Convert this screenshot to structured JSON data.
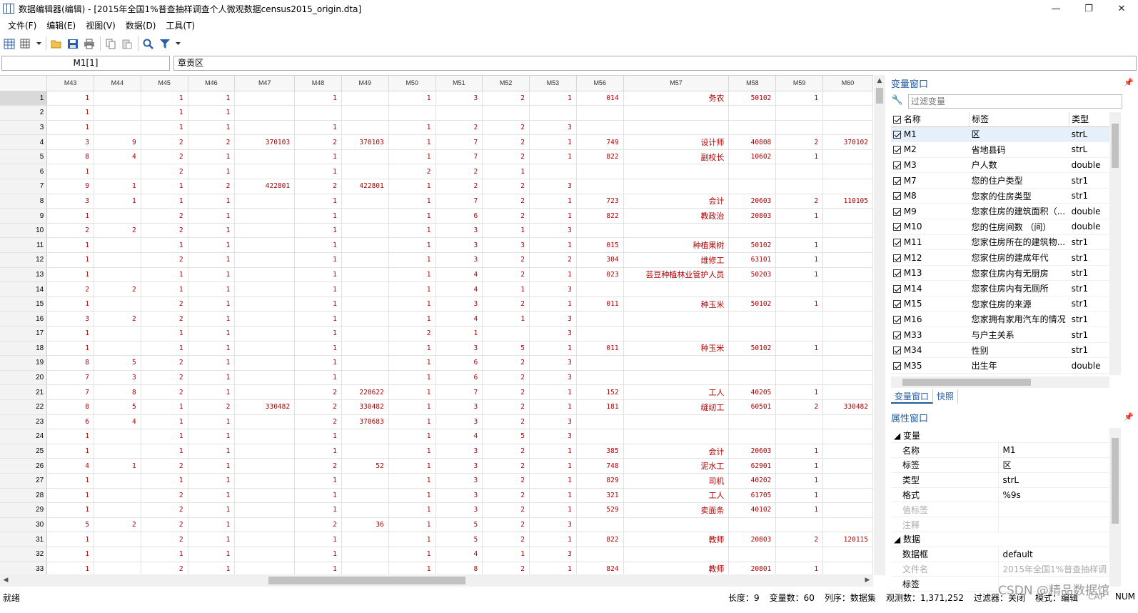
{
  "window": {
    "title": "数据编辑器(编辑) - [2015年全国1%普查抽样调查个人微观数据census2015_origin.dta]",
    "minimize": "—",
    "maximize": "❐",
    "close": "✕"
  },
  "menu": [
    "文件(F)",
    "编辑(E)",
    "视图(V)",
    "数据(D)",
    "工具(T)"
  ],
  "cellbar": {
    "name": "M1[1]",
    "value": "章贡区"
  },
  "grid": {
    "columns": [
      "M43",
      "M44",
      "M45",
      "M46",
      "M47",
      "M48",
      "M49",
      "M50",
      "M51",
      "M52",
      "M53",
      "M56",
      "M57",
      "M58",
      "M59",
      "M60"
    ],
    "rows": [
      [
        "1",
        "1",
        "",
        "1",
        "1",
        "",
        "1",
        "",
        "1",
        "3",
        "2",
        "1",
        "014",
        "务农",
        "50102",
        "1",
        ""
      ],
      [
        "2",
        "1",
        "",
        "1",
        "1",
        "",
        "",
        "",
        "",
        "",
        "",
        "",
        "",
        "",
        "",
        "",
        ""
      ],
      [
        "3",
        "1",
        "",
        "1",
        "1",
        "",
        "1",
        "",
        "1",
        "2",
        "2",
        "3",
        "",
        "",
        "",
        "",
        ""
      ],
      [
        "4",
        "3",
        "9",
        "2",
        "2",
        "370103",
        "2",
        "370103",
        "1",
        "7",
        "2",
        "1",
        "749",
        "设计师",
        "40808",
        "2",
        "370102"
      ],
      [
        "5",
        "8",
        "4",
        "2",
        "1",
        "",
        "1",
        "",
        "1",
        "7",
        "2",
        "1",
        "822",
        "副校长",
        "10602",
        "1",
        ""
      ],
      [
        "6",
        "1",
        "",
        "2",
        "1",
        "",
        "1",
        "",
        "2",
        "2",
        "1",
        "",
        "",
        "",
        "",
        "",
        ""
      ],
      [
        "7",
        "9",
        "1",
        "1",
        "2",
        "422801",
        "2",
        "422801",
        "1",
        "2",
        "2",
        "3",
        "",
        "",
        "",
        "",
        ""
      ],
      [
        "8",
        "3",
        "1",
        "1",
        "1",
        "",
        "1",
        "",
        "1",
        "7",
        "2",
        "1",
        "723",
        "会计",
        "20603",
        "2",
        "110105"
      ],
      [
        "9",
        "1",
        "",
        "2",
        "1",
        "",
        "1",
        "",
        "1",
        "6",
        "2",
        "1",
        "822",
        "教政治",
        "20803",
        "1",
        ""
      ],
      [
        "10",
        "2",
        "2",
        "2",
        "1",
        "",
        "1",
        "",
        "1",
        "3",
        "1",
        "3",
        "",
        "",
        "",
        "",
        ""
      ],
      [
        "11",
        "1",
        "",
        "1",
        "1",
        "",
        "1",
        "",
        "1",
        "3",
        "3",
        "1",
        "015",
        "种植果树",
        "50102",
        "1",
        ""
      ],
      [
        "12",
        "1",
        "",
        "2",
        "1",
        "",
        "1",
        "",
        "1",
        "3",
        "2",
        "2",
        "304",
        "维修工",
        "63101",
        "1",
        ""
      ],
      [
        "13",
        "1",
        "",
        "1",
        "1",
        "",
        "1",
        "",
        "1",
        "4",
        "2",
        "1",
        "023",
        "芸豆种植林业管护人员",
        "50203",
        "1",
        ""
      ],
      [
        "14",
        "2",
        "2",
        "1",
        "1",
        "",
        "1",
        "",
        "1",
        "4",
        "1",
        "3",
        "",
        "",
        "",
        "",
        ""
      ],
      [
        "15",
        "1",
        "",
        "2",
        "1",
        "",
        "1",
        "",
        "1",
        "3",
        "2",
        "1",
        "011",
        "种玉米",
        "50102",
        "1",
        ""
      ],
      [
        "16",
        "3",
        "2",
        "2",
        "1",
        "",
        "1",
        "",
        "1",
        "4",
        "1",
        "3",
        "",
        "",
        "",
        "",
        ""
      ],
      [
        "17",
        "1",
        "",
        "1",
        "1",
        "",
        "1",
        "",
        "2",
        "1",
        "",
        "3",
        "",
        "",
        "",
        "",
        ""
      ],
      [
        "18",
        "1",
        "",
        "1",
        "1",
        "",
        "1",
        "",
        "1",
        "3",
        "5",
        "1",
        "011",
        "种玉米",
        "50102",
        "1",
        ""
      ],
      [
        "19",
        "8",
        "5",
        "2",
        "1",
        "",
        "1",
        "",
        "1",
        "6",
        "2",
        "3",
        "",
        "",
        "",
        "",
        ""
      ],
      [
        "20",
        "7",
        "3",
        "2",
        "1",
        "",
        "1",
        "",
        "1",
        "6",
        "2",
        "3",
        "",
        "",
        "",
        "",
        ""
      ],
      [
        "21",
        "7",
        "8",
        "2",
        "1",
        "",
        "2",
        "220622",
        "1",
        "7",
        "2",
        "1",
        "152",
        "工人",
        "40205",
        "1",
        ""
      ],
      [
        "22",
        "8",
        "5",
        "1",
        "2",
        "330482",
        "2",
        "330482",
        "1",
        "3",
        "2",
        "1",
        "181",
        "缝纫工",
        "60501",
        "2",
        "330482"
      ],
      [
        "23",
        "6",
        "4",
        "1",
        "1",
        "",
        "2",
        "370683",
        "1",
        "3",
        "2",
        "3",
        "",
        "",
        "",
        "",
        ""
      ],
      [
        "24",
        "1",
        "",
        "1",
        "1",
        "",
        "1",
        "",
        "1",
        "4",
        "5",
        "3",
        "",
        "",
        "",
        "",
        ""
      ],
      [
        "25",
        "1",
        "",
        "1",
        "1",
        "",
        "1",
        "",
        "1",
        "3",
        "2",
        "1",
        "385",
        "会计",
        "20603",
        "1",
        ""
      ],
      [
        "26",
        "4",
        "1",
        "2",
        "1",
        "",
        "2",
        "52",
        "1",
        "3",
        "2",
        "1",
        "748",
        "泥水工",
        "62901",
        "1",
        ""
      ],
      [
        "27",
        "1",
        "",
        "1",
        "1",
        "",
        "1",
        "",
        "1",
        "3",
        "2",
        "1",
        "829",
        "司机",
        "40202",
        "1",
        ""
      ],
      [
        "28",
        "1",
        "",
        "2",
        "1",
        "",
        "1",
        "",
        "1",
        "3",
        "2",
        "1",
        "321",
        "工人",
        "61705",
        "1",
        ""
      ],
      [
        "29",
        "1",
        "",
        "2",
        "1",
        "",
        "1",
        "",
        "1",
        "3",
        "2",
        "1",
        "529",
        "卖面条",
        "40102",
        "1",
        ""
      ],
      [
        "30",
        "5",
        "2",
        "2",
        "1",
        "",
        "2",
        "36",
        "1",
        "5",
        "2",
        "3",
        "",
        "",
        "",
        "",
        ""
      ],
      [
        "31",
        "1",
        "",
        "2",
        "1",
        "",
        "1",
        "",
        "1",
        "5",
        "2",
        "1",
        "822",
        "教师",
        "20803",
        "2",
        "120115"
      ],
      [
        "32",
        "1",
        "",
        "1",
        "1",
        "",
        "1",
        "",
        "1",
        "4",
        "1",
        "3",
        "",
        "",
        "",
        "",
        ""
      ],
      [
        "33",
        "1",
        "",
        "2",
        "1",
        "",
        "1",
        "",
        "1",
        "8",
        "2",
        "1",
        "824",
        "教师",
        "20801",
        "1",
        ""
      ]
    ]
  },
  "var_window": {
    "title": "变量窗口",
    "filter_placeholder": "过滤变量",
    "headers": {
      "name": "名称",
      "label": "标签",
      "type": "类型"
    },
    "vars": [
      {
        "name": "M1",
        "label": "区",
        "type": "strL"
      },
      {
        "name": "M2",
        "label": "省地县码",
        "type": "strL"
      },
      {
        "name": "M3",
        "label": "户人数",
        "type": "double"
      },
      {
        "name": "M7",
        "label": "您的住户类型",
        "type": "str1"
      },
      {
        "name": "M8",
        "label": "您家的住房类型",
        "type": "str1"
      },
      {
        "name": "M9",
        "label": "您家住房的建筑面积（...",
        "type": "double"
      },
      {
        "name": "M10",
        "label": "您的住房间数 （间）",
        "type": "double"
      },
      {
        "name": "M11",
        "label": "您家住房所在的建筑物...",
        "type": "str1"
      },
      {
        "name": "M12",
        "label": "您家住房的建成年代",
        "type": "str1"
      },
      {
        "name": "M13",
        "label": "您家住房内有无厨房",
        "type": "str1"
      },
      {
        "name": "M14",
        "label": "您家住房内有无厕所",
        "type": "str1"
      },
      {
        "name": "M15",
        "label": "您家住房的来源",
        "type": "str1"
      },
      {
        "name": "M16",
        "label": "您家拥有家用汽车的情况",
        "type": "str1"
      },
      {
        "name": "M33",
        "label": "与户主关系",
        "type": "str1"
      },
      {
        "name": "M34",
        "label": "性别",
        "type": "str1"
      },
      {
        "name": "M35",
        "label": "出生年",
        "type": "double"
      }
    ],
    "tabs": [
      "变量窗口",
      "快照"
    ]
  },
  "prop_window": {
    "title": "属性窗口",
    "group_var": "变量",
    "var_props": [
      {
        "k": "名称",
        "v": "M1",
        "dim": false
      },
      {
        "k": "标签",
        "v": "区",
        "dim": false
      },
      {
        "k": "类型",
        "v": "strL",
        "dim": false
      },
      {
        "k": "格式",
        "v": "%9s",
        "dim": false
      },
      {
        "k": "值标签",
        "v": "",
        "dim": true
      },
      {
        "k": "注释",
        "v": "",
        "dim": true
      }
    ],
    "group_data": "数据",
    "data_props": [
      {
        "k": "数据框",
        "v": "default",
        "dim": false
      },
      {
        "k": "文件名",
        "v": "2015年全国1%普查抽样调",
        "dim": true
      },
      {
        "k": "标签",
        "v": "",
        "dim": false
      }
    ]
  },
  "status": {
    "left": "就绪",
    "length": "长度：9",
    "varcount": "变量数：60",
    "order": "列序：数据集",
    "obs": "观测数：1,371,252",
    "filter": "过滤器：关闭",
    "mode": "模式：编辑",
    "cap": "CAP",
    "num": "NUM"
  },
  "watermark": "CSDN @精品数据馆"
}
